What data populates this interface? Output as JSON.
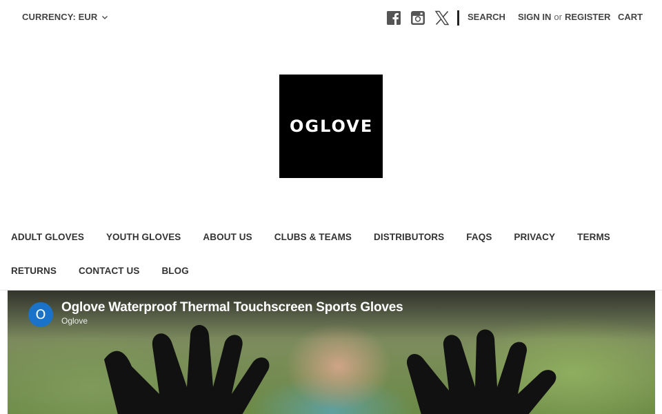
{
  "header": {
    "currency_label": "CURRENCY: EUR",
    "social": [
      "facebook-icon",
      "instagram-icon",
      "x-icon"
    ],
    "search_label": "SEARCH",
    "signin_label": "SIGN IN",
    "or_label": "or",
    "register_label": "REGISTER",
    "cart_label": "CART"
  },
  "logo": {
    "text": "OGLOVE"
  },
  "nav": {
    "row1": [
      "ADULT GLOVES",
      "YOUTH GLOVES",
      "ABOUT US",
      "CLUBS & TEAMS",
      "DISTRIBUTORS",
      "FAQS",
      "PRIVACY",
      "TERMS"
    ],
    "row2": [
      "RETURNS",
      "CONTACT US",
      "BLOG"
    ]
  },
  "video": {
    "avatar_letter": "O",
    "title": "Oglove Waterproof Thermal Touchscreen Sports Gloves",
    "channel": "Oglove",
    "avatar_color": "#1a73c8"
  }
}
